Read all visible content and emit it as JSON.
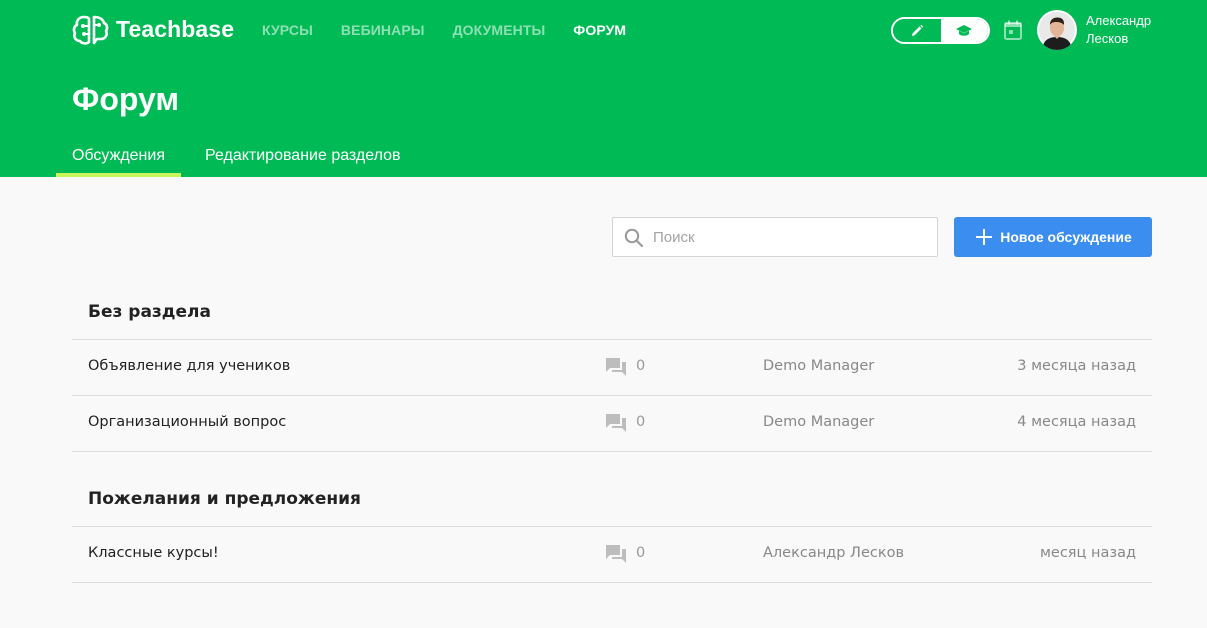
{
  "brand": {
    "name": "Teachbase"
  },
  "nav": [
    {
      "label": "КУРСЫ",
      "active": false
    },
    {
      "label": "ВЕБИНАРЫ",
      "active": false
    },
    {
      "label": "ДОКУМЕНТЫ",
      "active": false
    },
    {
      "label": "ФОРУМ",
      "active": true
    }
  ],
  "user": {
    "first_name": "Александр",
    "last_name": "Лесков"
  },
  "page": {
    "title": "Форум"
  },
  "tabs": [
    {
      "label": "Обсуждения",
      "active": true
    },
    {
      "label": "Редактирование разделов",
      "active": false
    }
  ],
  "search": {
    "placeholder": "Поиск",
    "value": ""
  },
  "new_discussion_button": {
    "label": "Новое обсуждение"
  },
  "sections": [
    {
      "title": "Без раздела",
      "rows": [
        {
          "title": "Объявление для учеников",
          "comments": "0",
          "author": "Demo Manager",
          "time": "3 месяца назад"
        },
        {
          "title": "Организационный вопрос",
          "comments": "0",
          "author": "Demo Manager",
          "time": "4 месяца назад"
        }
      ]
    },
    {
      "title": "Пожелания и предложения",
      "rows": [
        {
          "title": "Классные курсы!",
          "comments": "0",
          "author": "Александр Лесков",
          "time": "месяц назад"
        }
      ]
    }
  ],
  "colors": {
    "brand_green": "#00bb55",
    "tab_underline": "#c8f55a",
    "primary_button": "#3b8df0"
  }
}
